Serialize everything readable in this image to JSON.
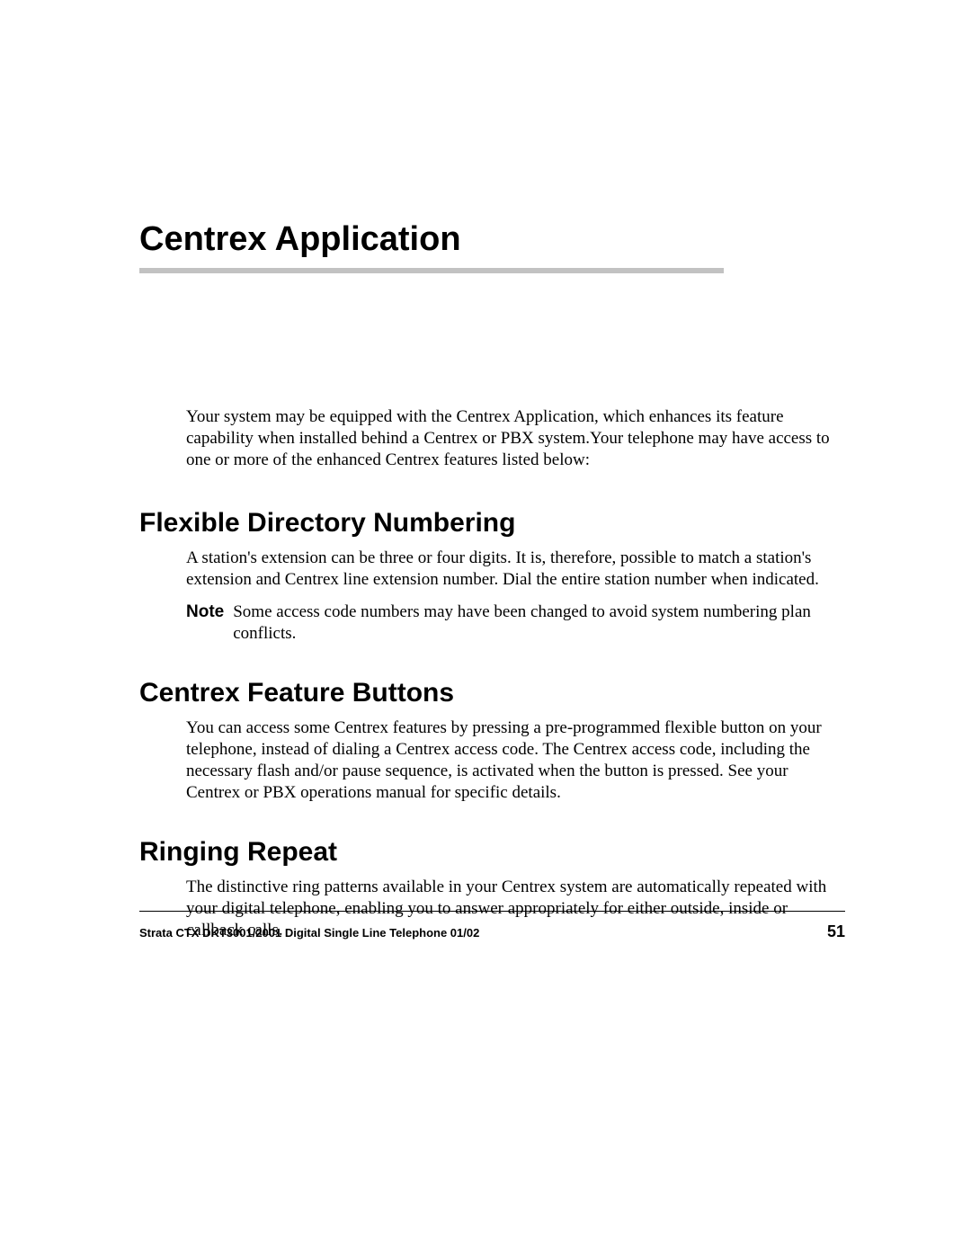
{
  "chapter": {
    "title": "Centrex Application"
  },
  "intro": "Your system may be equipped with the Centrex Application, which enhances its feature capability when installed behind a Centrex or PBX system.Your telephone may have access to one or more of the enhanced Centrex features listed below:",
  "sections": [
    {
      "heading": "Flexible Directory Numbering",
      "body": "A station's extension can be three or four digits. It is, therefore, possible to match a station's extension and Centrex line extension number. Dial the entire station number when indicated.",
      "note_label": "Note",
      "note_text": "Some access code numbers may have been changed to avoid system numbering plan conflicts."
    },
    {
      "heading": "Centrex Feature Buttons",
      "body": "You can access some Centrex features by pressing a pre-programmed flexible button on your telephone, instead of dialing a Centrex access code. The Centrex access code, including the necessary flash and/or pause sequence, is activated when the button is pressed. See your Centrex or PBX operations manual for specific details."
    },
    {
      "heading": "Ringing Repeat",
      "body": "The distinctive ring patterns available in your Centrex system are automatically repeated with your digital telephone, enabling you to answer appropriately for either outside, inside or callback calls."
    }
  ],
  "footer": {
    "text": "Strata CTX DKT3001/2001 Digital Single Line Telephone    01/02",
    "page": "51"
  }
}
